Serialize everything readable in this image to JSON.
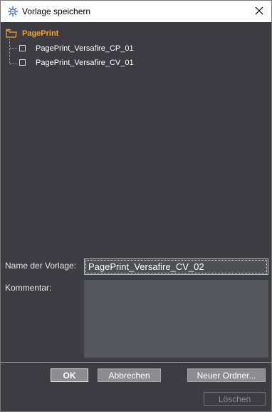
{
  "window": {
    "title": "Vorlage speichern",
    "icon": "gear-document-icon",
    "close_icon": "close-icon"
  },
  "tree": {
    "root": {
      "label": "PagePrint",
      "icon": "folder-icon"
    },
    "items": [
      {
        "label": "PagePrint_Versafire_CP_01",
        "icon": "document-icon"
      },
      {
        "label": "PagePrint_Versafire_CV_01",
        "icon": "document-icon"
      }
    ]
  },
  "form": {
    "name_label": "Name der Vorlage:",
    "name_value": "PagePrint_Versafire_CV_02",
    "comment_label": "Kommentar:",
    "comment_value": ""
  },
  "buttons": {
    "ok": "OK",
    "cancel": "Abbrechen",
    "new_folder": "Neuer Ordner...",
    "delete": "Löschen"
  },
  "colors": {
    "background": "#3c3c42",
    "accent_orange": "#f3a533",
    "button": "#8d8d91",
    "input": "#4f4f56"
  }
}
